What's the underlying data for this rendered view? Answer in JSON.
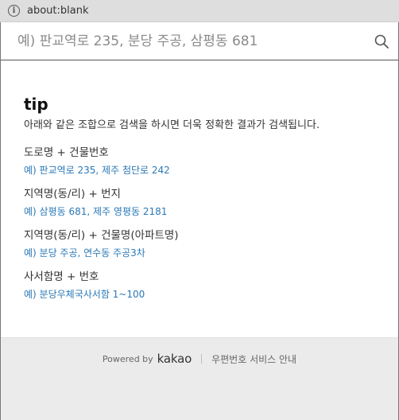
{
  "browser": {
    "url": "about:blank",
    "info_icon": "info-icon"
  },
  "search": {
    "placeholder": "예) 판교역로 235, 분당 주공, 삼평동 681",
    "value": "",
    "button_icon": "search-icon"
  },
  "tip": {
    "title": "tip",
    "description": "아래와 같은 조합으로 검색을 하시면 더욱 정확한 결과가 검색됩니다.",
    "items": [
      {
        "label": "도로명 + 건물번호",
        "example": "예) 판교역로 235,  제주 첨단로 242"
      },
      {
        "label": "지역명(동/리) + 번지",
        "example": "예) 삼평동 681,  제주 영평동 2181"
      },
      {
        "label": "지역명(동/리) + 건물명(아파트명)",
        "example": "예) 분당 주공,  연수동 주공3차"
      },
      {
        "label": "사서함명 + 번호",
        "example": "예) 분당우체국사서함 1~100"
      }
    ]
  },
  "footer": {
    "powered_by": "Powered by",
    "logo_text": "kakao",
    "service_link": "우편번호 서비스 안내"
  },
  "colors": {
    "example_text": "#2a79b7",
    "footer_bg": "#ebebeb",
    "search_border": "#555555"
  }
}
